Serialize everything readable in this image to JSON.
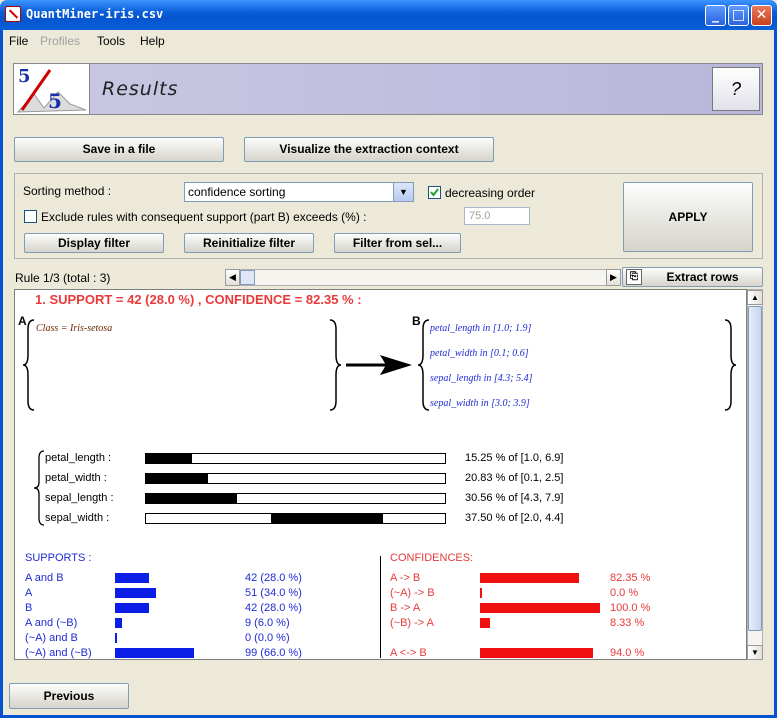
{
  "window": {
    "title": "QuantMiner-iris.csv",
    "minimize": "_",
    "maximize": "□",
    "close": "✕"
  },
  "menu": {
    "file": "File",
    "profiles": "Profiles",
    "tools": "Tools",
    "help": "Help"
  },
  "header": {
    "title": "Results",
    "help_button": "?",
    "logo_top": "5",
    "logo_bottom": "5"
  },
  "actions": {
    "save": "Save in a file",
    "visualize": "Visualize the extraction context"
  },
  "filter": {
    "sorting_label": "Sorting method :",
    "sorting_value": "confidence sorting",
    "decreasing_label": "decreasing order",
    "decreasing_checked": true,
    "exclude_label": "Exclude rules with consequent support (part B) exceeds (%) :",
    "exclude_checked": false,
    "threshold_value": "75.0",
    "display_filter": "Display filter",
    "reinitialize": "Reinitialize filter",
    "filter_from_sel": "Filter from sel...",
    "apply": "APPLY"
  },
  "rule_nav": {
    "label": "Rule 1/3 (total : 3)",
    "extract_rows": "Extract rows",
    "position": 0
  },
  "rule": {
    "headline": "1. SUPPORT = 42 (28.0 %) , CONFIDENCE = 82.35 %  :",
    "part_a_label": "A",
    "part_b_label": "B",
    "part_a_items": [
      "Class = Iris-setosa"
    ],
    "part_b_items": [
      "petal_length in [1.0; 1.9]",
      "petal_width in [0.1; 0.6]",
      "sepal_length in [4.3; 5.4]",
      "sepal_width in [3.0; 3.9]"
    ]
  },
  "intervals": [
    {
      "name": "petal_length :",
      "start": 0.0,
      "end": 0.1525,
      "text": "15.25 % of [1.0, 6.9]"
    },
    {
      "name": "petal_width  :",
      "start": 0.0,
      "end": 0.2083,
      "text": "20.83 % of [0.1, 2.5]"
    },
    {
      "name": "sepal_length :",
      "start": 0.0,
      "end": 0.3056,
      "text": "30.56 % of [4.3, 7.9]"
    },
    {
      "name": "sepal_width :",
      "start": 0.4167,
      "end": 0.7917,
      "text": "37.50 % of [2.0, 4.4]"
    }
  ],
  "supports": {
    "title": "SUPPORTS :",
    "color": "#0a1ee6",
    "rows": [
      {
        "label": "A and B",
        "value": 28.0,
        "text": "42 (28.0 %)"
      },
      {
        "label": "A",
        "value": 34.0,
        "text": "51 (34.0 %)"
      },
      {
        "label": "B",
        "value": 28.0,
        "text": "42 (28.0 %)"
      },
      {
        "label": "A and (~B)",
        "value": 6.0,
        "text": "9 (6.0 %)"
      },
      {
        "label": "(~A) and B",
        "value": 0.0,
        "text": "0 (0.0 %)"
      },
      {
        "label": "(~A) and (~B)",
        "value": 66.0,
        "text": "99 (66.0 %)"
      }
    ]
  },
  "confidences": {
    "title": "CONFIDENCES:",
    "color": "#f01010",
    "rows": [
      {
        "label": "A -> B",
        "value": 82.35,
        "text": "82.35 %"
      },
      {
        "label": "(~A) -> B",
        "value": 0.0,
        "text": "0.0 %"
      },
      {
        "label": "B -> A",
        "value": 100.0,
        "text": "100.0 %"
      },
      {
        "label": "(~B) -> A",
        "value": 8.33,
        "text": "8.33 %"
      },
      {
        "label": "A <-> B",
        "value": 94.0,
        "text": "94.0 %"
      }
    ]
  },
  "footer": {
    "previous": "Previous"
  }
}
